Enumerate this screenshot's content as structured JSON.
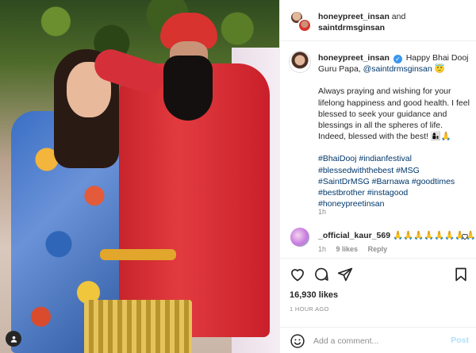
{
  "header": {
    "user1": "honeypreet_insan",
    "and": "and",
    "user2": "saintdrmsginsan"
  },
  "caption": {
    "username": "honeypreet_insan",
    "greeting": "Happy Bhai Dooj Guru Papa,",
    "mention": "@saintdrmsginsan",
    "greeting_emoji": "😇",
    "body": "Always praying and wishing for your lifelong happiness and good health. I feel blessed to seek your guidance and blessings in all the spheres of life. Indeed, blessed with the best! 👩‍👦🙏",
    "hashtags": "#BhaiDooj #indianfestival #blessedwiththebest #MSG #SaintDrMSG #Barnawa #goodtimes #bestbrother #instagood #honeypreetinsan",
    "time": "1h"
  },
  "comment": {
    "username": "_official_kaur_569",
    "text": "🙏🙏🙏🙏🙏🙏🙏🙏",
    "time": "1h",
    "likes": "9 likes",
    "reply": "Reply"
  },
  "actions": {
    "likes": "16,930 likes",
    "ago": "1 HOUR AGO",
    "comment_placeholder": "Add a comment...",
    "post_label": "Post"
  },
  "icons": {
    "verified": "verified-badge-icon",
    "like": "heart-icon",
    "comment": "comment-icon",
    "share": "paper-plane-icon",
    "save": "bookmark-icon",
    "emoji": "smiley-icon",
    "tag": "user-tag-icon"
  },
  "colors": {
    "link": "#00376b",
    "verified": "#3897f0",
    "post_button": "#b2dffc",
    "muted": "#8e8e8e"
  }
}
